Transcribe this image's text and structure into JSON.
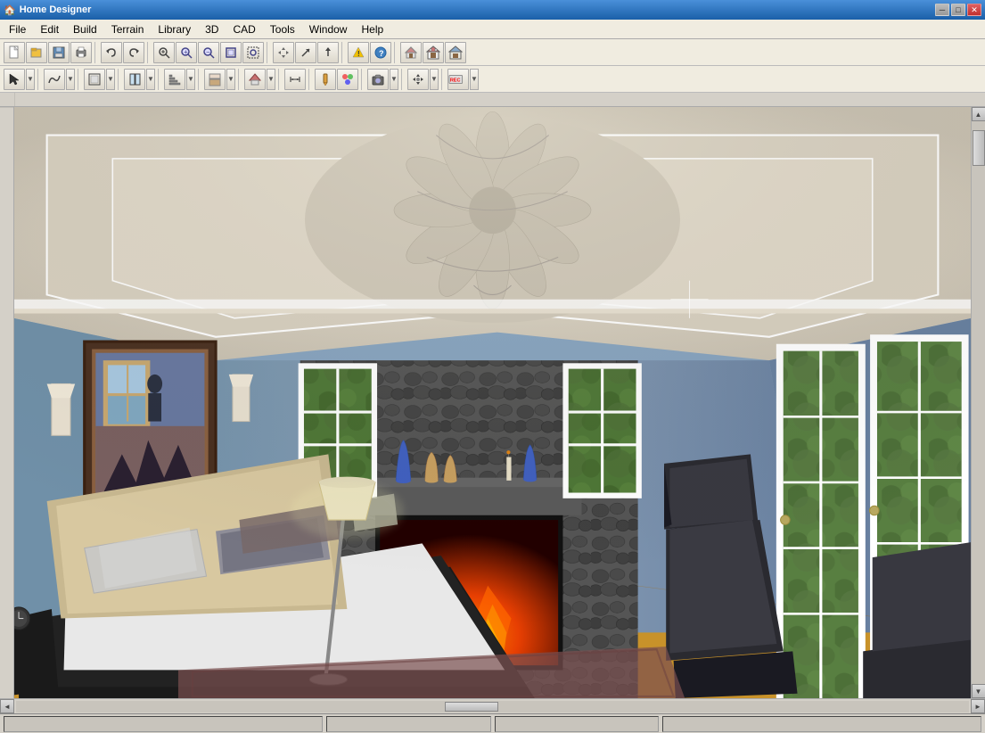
{
  "app": {
    "title": "Home Designer",
    "icon": "🏠"
  },
  "title_bar": {
    "minimize_label": "─",
    "maximize_label": "□",
    "close_label": "✕"
  },
  "menu": {
    "items": [
      "File",
      "Edit",
      "Build",
      "Terrain",
      "Library",
      "3D",
      "CAD",
      "Tools",
      "Window",
      "Help"
    ]
  },
  "toolbar1": {
    "buttons": [
      {
        "name": "new",
        "icon": "📄"
      },
      {
        "name": "open",
        "icon": "📁"
      },
      {
        "name": "save",
        "icon": "💾"
      },
      {
        "name": "print",
        "icon": "🖨"
      },
      {
        "name": "undo",
        "icon": "↩"
      },
      {
        "name": "redo",
        "icon": "↪"
      },
      {
        "name": "zoom-in-glass",
        "icon": "🔍"
      },
      {
        "name": "zoom-in",
        "icon": "⊕"
      },
      {
        "name": "zoom-out",
        "icon": "⊖"
      },
      {
        "name": "fit",
        "icon": "⊞"
      },
      {
        "name": "zoom-box",
        "icon": "⊟"
      },
      {
        "name": "pan",
        "icon": "✋"
      },
      {
        "name": "arrow1",
        "icon": "↗"
      },
      {
        "name": "arrow2",
        "icon": "↑"
      },
      {
        "name": "exclaim",
        "icon": "❗"
      },
      {
        "name": "help",
        "icon": "?"
      },
      {
        "name": "house1",
        "icon": "⌂"
      },
      {
        "name": "house2",
        "icon": "🏠"
      },
      {
        "name": "house3",
        "icon": "🏡"
      }
    ]
  },
  "toolbar2": {
    "buttons": [
      {
        "name": "select",
        "icon": "↖"
      },
      {
        "name": "curve",
        "icon": "∿"
      },
      {
        "name": "wall",
        "icon": "⊓"
      },
      {
        "name": "door-window",
        "icon": "▦"
      },
      {
        "name": "stair",
        "icon": "⊏"
      },
      {
        "name": "floor",
        "icon": "⊡"
      },
      {
        "name": "roof",
        "icon": "⌂"
      },
      {
        "name": "dimension",
        "icon": "↔"
      },
      {
        "name": "paint",
        "icon": "✏"
      },
      {
        "name": "material",
        "icon": "🎨"
      },
      {
        "name": "camera",
        "icon": "📷"
      },
      {
        "name": "move",
        "icon": "✥"
      },
      {
        "name": "rotate",
        "icon": "↻"
      },
      {
        "name": "rec",
        "icon": "⏺"
      }
    ]
  },
  "scrollbar": {
    "up": "▲",
    "down": "▼",
    "left": "◄",
    "right": "►"
  },
  "status_bar": {
    "panels": [
      "",
      "",
      "",
      ""
    ]
  },
  "scene": {
    "description": "3D bedroom interior with fireplace, bed, and windows"
  }
}
